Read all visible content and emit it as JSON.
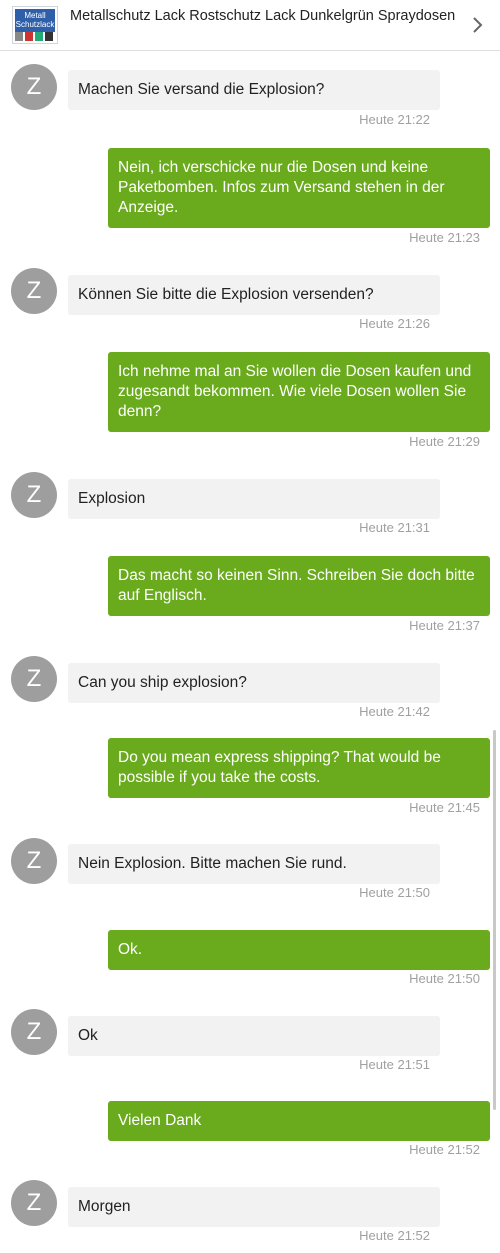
{
  "header": {
    "thumbnail_line1": "Metall",
    "thumbnail_line2": "Schutzlack",
    "title": "Metallschutz Lack Rostschutz Lack Dunkelgrün Spraydosen"
  },
  "avatar_letter": "Z",
  "messages": [
    {
      "dir": "in",
      "text": "Machen Sie versand die Explosion?",
      "time": "Heute 21:22"
    },
    {
      "dir": "out",
      "text": "Nein, ich verschicke nur die Dosen und keine Paketbomben. Infos zum Versand stehen in der Anzeige.",
      "time": "Heute 21:23"
    },
    {
      "dir": "in",
      "text": "Können Sie bitte die Explosion versenden?",
      "time": "Heute 21:26"
    },
    {
      "dir": "out",
      "text": "Ich nehme mal an Sie wollen die Dosen kaufen und zugesandt bekommen. Wie viele Dosen wollen Sie denn?",
      "time": "Heute 21:29"
    },
    {
      "dir": "in",
      "text": "Explosion",
      "time": "Heute 21:31"
    },
    {
      "dir": "out",
      "text": "Das macht so keinen Sinn. Schreiben Sie doch bitte auf Englisch.",
      "time": "Heute 21:37"
    },
    {
      "dir": "in",
      "text": "Can you ship explosion?",
      "time": "Heute 21:42"
    },
    {
      "dir": "out",
      "text": "Do you mean express shipping? That would be possible if you take the costs.",
      "time": "Heute 21:45"
    },
    {
      "dir": "in",
      "text": "Nein Explosion. Bitte machen Sie rund.",
      "time": "Heute 21:50"
    },
    {
      "dir": "out",
      "text": "Ok.",
      "time": "Heute 21:50"
    },
    {
      "dir": "in",
      "text": "Ok",
      "time": "Heute 21:51"
    },
    {
      "dir": "out",
      "text": "Vielen Dank",
      "time": "Heute 21:52"
    },
    {
      "dir": "in",
      "text": "Morgen",
      "time": "Heute 21:52"
    }
  ],
  "colors": {
    "outgoing_bubble": "#6aab1e",
    "incoming_bubble": "#f2f2f2",
    "avatar": "#9e9e9e",
    "timestamp": "#a0a0a0"
  }
}
